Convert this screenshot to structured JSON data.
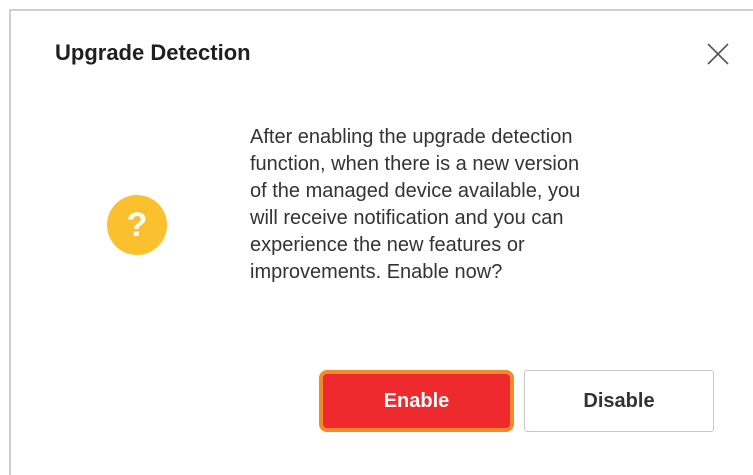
{
  "dialog": {
    "title": "Upgrade Detection",
    "close_icon": "close-icon",
    "icon": "question-icon",
    "icon_glyph": "?",
    "icon_color": "#fbc02d",
    "message_lines": [
      "After enabling the upgrade detection",
      "function, when there is a new version",
      "of the managed device available, you",
      "will receive notification and you can",
      "experience the new features or",
      "improvements. Enable now?"
    ],
    "buttons": {
      "enable_label": "Enable",
      "disable_label": "Disable"
    },
    "colors": {
      "enable_bg": "#ee2a2f",
      "enable_focus_ring": "#f08a2c"
    }
  }
}
